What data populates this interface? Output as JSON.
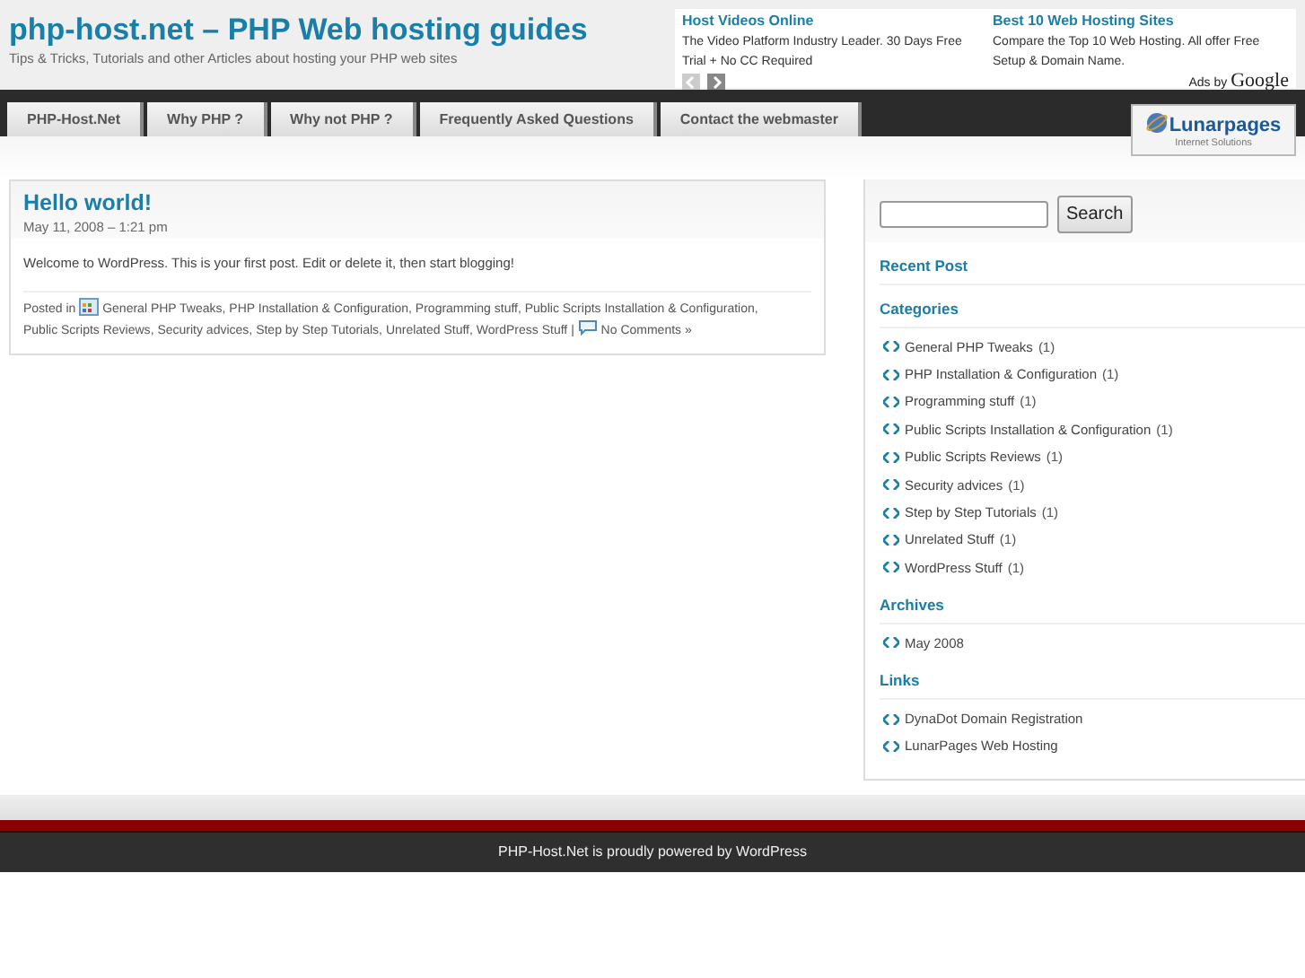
{
  "header": {
    "title": "php-host.net – PHP Web hosting guides",
    "tagline": "Tips & Tricks, Tutorials and other Articles about hosting your PHP web sites"
  },
  "ads": [
    {
      "title": "Host Videos Online",
      "text": "The Video Platform Industry Leader. 30 Days Free Trial + No CC Required"
    },
    {
      "title": "Best 10 Web Hosting Sites",
      "text": "Compare the Top 10 Web Hosting. All offer Free Setup & Domain Name."
    }
  ],
  "ads_by": {
    "label": "Ads by",
    "brand": "Google"
  },
  "nav": [
    "PHP-Host.Net",
    "Why PHP ?",
    "Why not PHP ?",
    "Frequently Asked Questions",
    "Contact the webmaster"
  ],
  "sponsor": {
    "name": "Lunarpages",
    "tagline": "Internet Solutions"
  },
  "post": {
    "title": "Hello world!",
    "date": "May 11, 2008 – 1:21 pm",
    "body": "Welcome to WordPress. This is your first post. Edit or delete it, then start blogging!",
    "posted_in": "Posted in",
    "category_separator": ",",
    "categories": [
      "General PHP Tweaks",
      "PHP Installation & Configuration",
      "Programming stuff",
      "Public Scripts Installation & Configuration",
      "Public Scripts Reviews",
      "Security advices",
      "Step by Step Tutorials",
      "Unrelated Stuff",
      "WordPress Stuff"
    ],
    "separator": "|",
    "comments": "No Comments »"
  },
  "sidebar": {
    "search_button": "Search",
    "sections": [
      {
        "title": "Recent Post"
      },
      {
        "title": "Categories",
        "items": [
          {
            "label": "General PHP Tweaks",
            "count": "(1)"
          },
          {
            "label": "PHP Installation & Configuration",
            "count": "(1)"
          },
          {
            "label": "Programming stuff",
            "count": "(1)"
          },
          {
            "label": "Public Scripts Installation & Configuration",
            "count": "(1)"
          },
          {
            "label": "Public Scripts Reviews",
            "count": "(1)"
          },
          {
            "label": "Security advices",
            "count": "(1)"
          },
          {
            "label": "Step by Step Tutorials",
            "count": "(1)"
          },
          {
            "label": "Unrelated Stuff",
            "count": "(1)"
          },
          {
            "label": "WordPress Stuff",
            "count": "(1)"
          }
        ]
      },
      {
        "title": "Archives",
        "items": [
          {
            "label": "May 2008"
          }
        ]
      },
      {
        "title": "Links",
        "items": [
          {
            "label": "DynaDot Domain Registration"
          },
          {
            "label": "LunarPages Web Hosting"
          }
        ]
      }
    ]
  },
  "footer": {
    "text": "PHP-Host.Net is proudly powered by",
    "link": "WordPress"
  }
}
